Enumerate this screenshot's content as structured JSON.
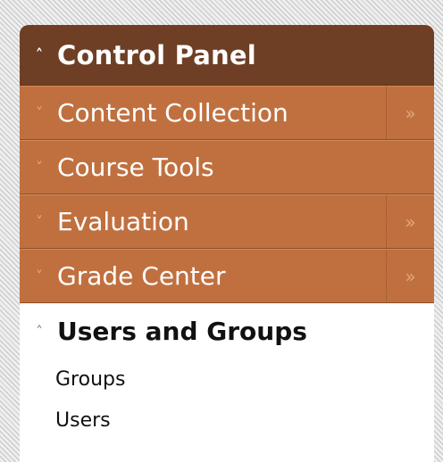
{
  "control_panel": {
    "title": "Control Panel",
    "expand_icon": "double-chevron-up-icon"
  },
  "menu": {
    "items": [
      {
        "label": "Content Collection",
        "has_more": true
      },
      {
        "label": "Course Tools",
        "has_more": false
      },
      {
        "label": "Evaluation",
        "has_more": true
      },
      {
        "label": "Grade Center",
        "has_more": true
      }
    ]
  },
  "users_and_groups": {
    "title": "Users and Groups",
    "links": [
      "Groups",
      "Users"
    ]
  },
  "colors": {
    "header_bg": "#6e3f25",
    "menu_bg": "#c0703f",
    "text_white": "#ffffff"
  }
}
